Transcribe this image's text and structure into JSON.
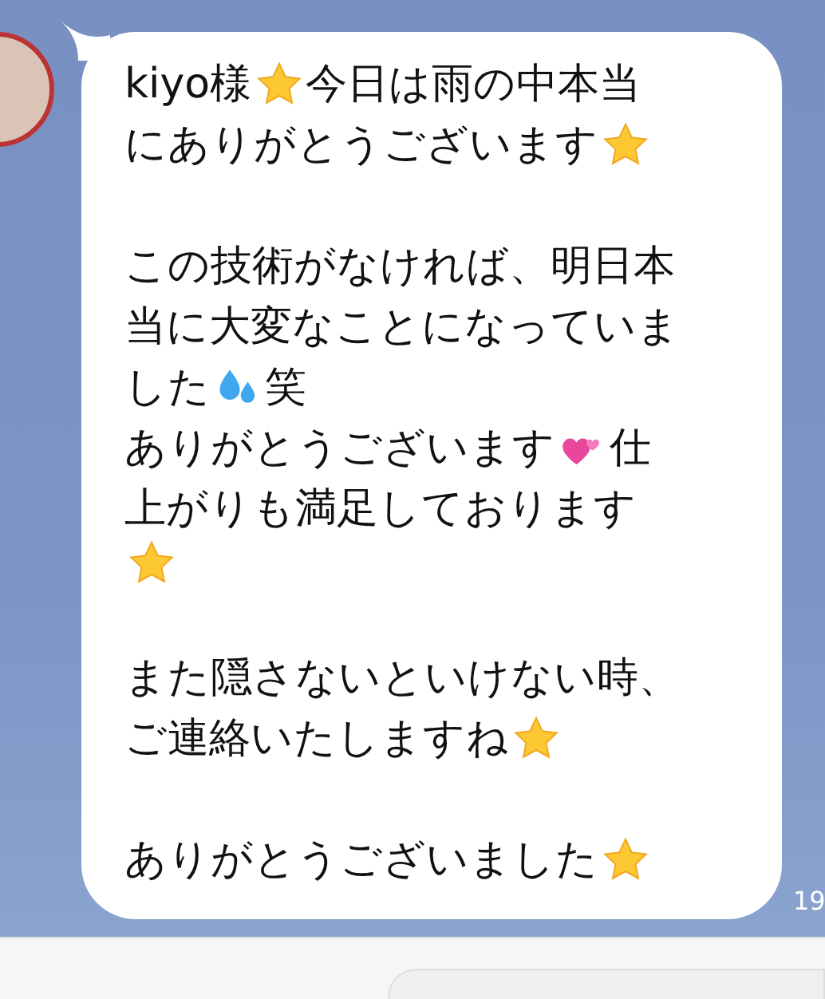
{
  "message": {
    "paragraphs": [
      [
        [
          {
            "kind": "text",
            "text": "kiyo様"
          },
          {
            "kind": "star"
          },
          {
            "kind": "text",
            "text": "今日は雨の中本当"
          }
        ],
        [
          {
            "kind": "text",
            "text": "にありがとうございます"
          },
          {
            "kind": "star"
          }
        ]
      ],
      [
        [
          {
            "kind": "text",
            "text": "この技術がなければ、明日本"
          }
        ],
        [
          {
            "kind": "text",
            "text": "当に大変なことになっていま"
          }
        ],
        [
          {
            "kind": "text",
            "text": "した"
          },
          {
            "kind": "drops"
          },
          {
            "kind": "text",
            "text": "笑"
          }
        ],
        [
          {
            "kind": "text",
            "text": "ありがとうございます"
          },
          {
            "kind": "hearts"
          },
          {
            "kind": "text",
            "text": "仕"
          }
        ],
        [
          {
            "kind": "text",
            "text": "上がりも満足しております"
          }
        ],
        [
          {
            "kind": "star"
          }
        ]
      ],
      [
        [
          {
            "kind": "text",
            "text": "また隠さないといけない時、"
          }
        ],
        [
          {
            "kind": "text",
            "text": "ご連絡いたしますね"
          },
          {
            "kind": "star"
          }
        ]
      ],
      [
        [
          {
            "kind": "text",
            "text": "ありがとうございました"
          },
          {
            "kind": "star"
          }
        ]
      ]
    ],
    "time": "19"
  }
}
